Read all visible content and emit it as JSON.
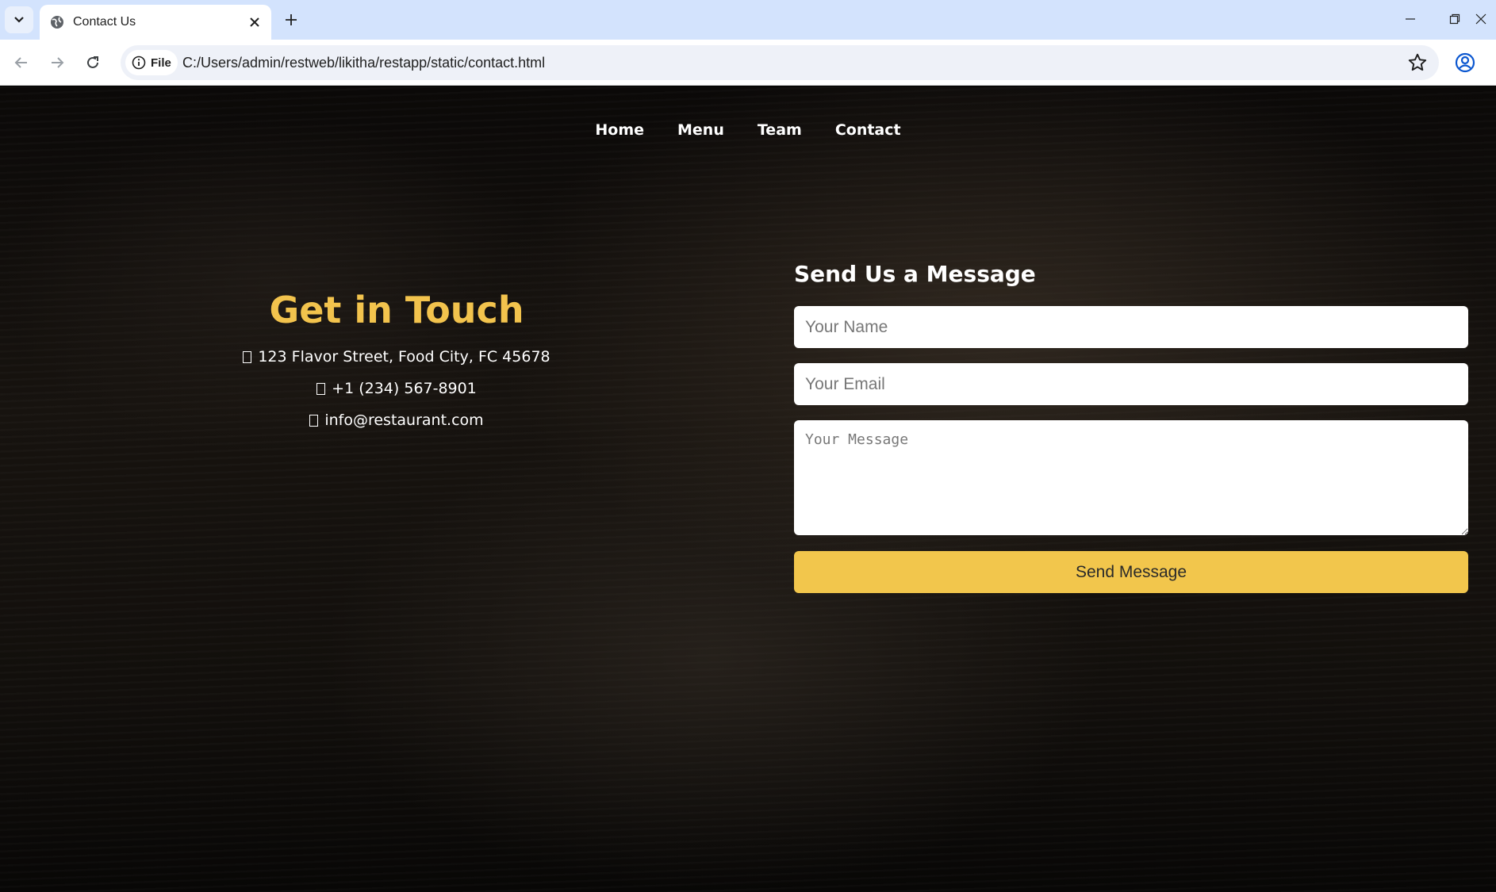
{
  "browser": {
    "tab_title": "Contact Us",
    "site_info_label": "File",
    "url": "C:/Users/admin/restweb/likitha/restapp/static/contact.html"
  },
  "nav": {
    "items": [
      "Home",
      "Menu",
      "Team",
      "Contact"
    ]
  },
  "contact": {
    "heading": "Get in Touch",
    "address": "123 Flavor Street, Food City, FC 45678",
    "phone": "+1 (234) 567-8901",
    "email": "info@restaurant.com"
  },
  "form": {
    "heading": "Send Us a Message",
    "name_placeholder": "Your Name",
    "email_placeholder": "Your Email",
    "message_placeholder": "Your Message",
    "submit_label": "Send Message"
  },
  "colors": {
    "accent": "#f2c34d",
    "button": "#f2c64c",
    "tab_strip": "#d3e3fd"
  }
}
